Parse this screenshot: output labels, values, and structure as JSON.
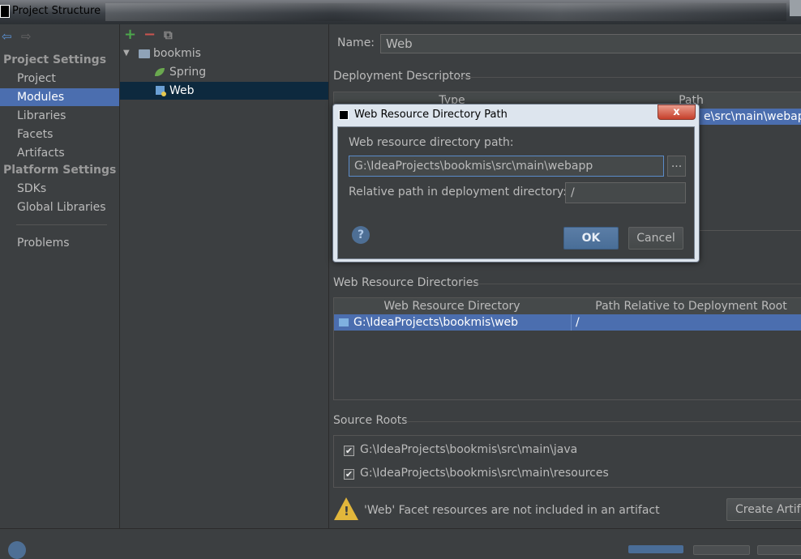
{
  "window": {
    "title": "Project Structure"
  },
  "sidebar": {
    "sections": [
      {
        "label": "Project Settings",
        "items": [
          "Project",
          "Modules",
          "Libraries",
          "Facets",
          "Artifacts"
        ]
      },
      {
        "label": "Platform Settings",
        "items": [
          "SDKs",
          "Global Libraries"
        ]
      }
    ],
    "problems": "Problems",
    "selected": "Modules"
  },
  "tree": {
    "toolbar": {
      "add": "+",
      "remove": "−",
      "copy": "⧉"
    },
    "root": "bookmis",
    "children": [
      "Spring",
      "Web"
    ],
    "selected": "Web"
  },
  "module": {
    "name_label": "Name:",
    "name_value": "Web",
    "deployment_descriptors": {
      "title": "Deployment Descriptors",
      "columns": [
        "Type",
        "Path"
      ],
      "row_path_fragment": "e\\src\\main\\webapp"
    },
    "web_resource_dirs": {
      "title": "Web Resource Directories",
      "columns": [
        "Web Resource Directory",
        "Path Relative to Deployment Root"
      ],
      "rows": [
        {
          "directory": "G:\\IdeaProjects\\bookmis\\web",
          "relative": "/"
        }
      ]
    },
    "source_roots": {
      "title": "Source Roots",
      "items": [
        {
          "path": "G:\\IdeaProjects\\bookmis\\src\\main\\java",
          "checked": true
        },
        {
          "path": "G:\\IdeaProjects\\bookmis\\src\\main\\resources",
          "checked": true
        }
      ]
    },
    "warning": "'Web' Facet resources are not included in an artifact",
    "create_artifact_button": "Create Artifa"
  },
  "dialog": {
    "title": "Web Resource Directory Path",
    "close": "x",
    "path_label": "Web resource directory path:",
    "path_value": "G:\\IdeaProjects\\bookmis\\src\\main\\webapp",
    "browse": "...",
    "relative_label": "Relative path in deployment directory:",
    "relative_value": "/",
    "help": "?",
    "ok": "OK",
    "cancel": "Cancel"
  },
  "colors": {
    "background": "#3c3f41",
    "selection": "#4b6eaf",
    "tree_selection": "#0d293e",
    "text": "#bbbbbb",
    "add_icon": "#4ca64c",
    "remove_icon": "#c75450"
  },
  "icons": [
    "back-arrow-icon",
    "forward-arrow-icon",
    "folder-icon",
    "spring-leaf-icon",
    "web-module-icon",
    "warning-icon",
    "help-icon"
  ]
}
